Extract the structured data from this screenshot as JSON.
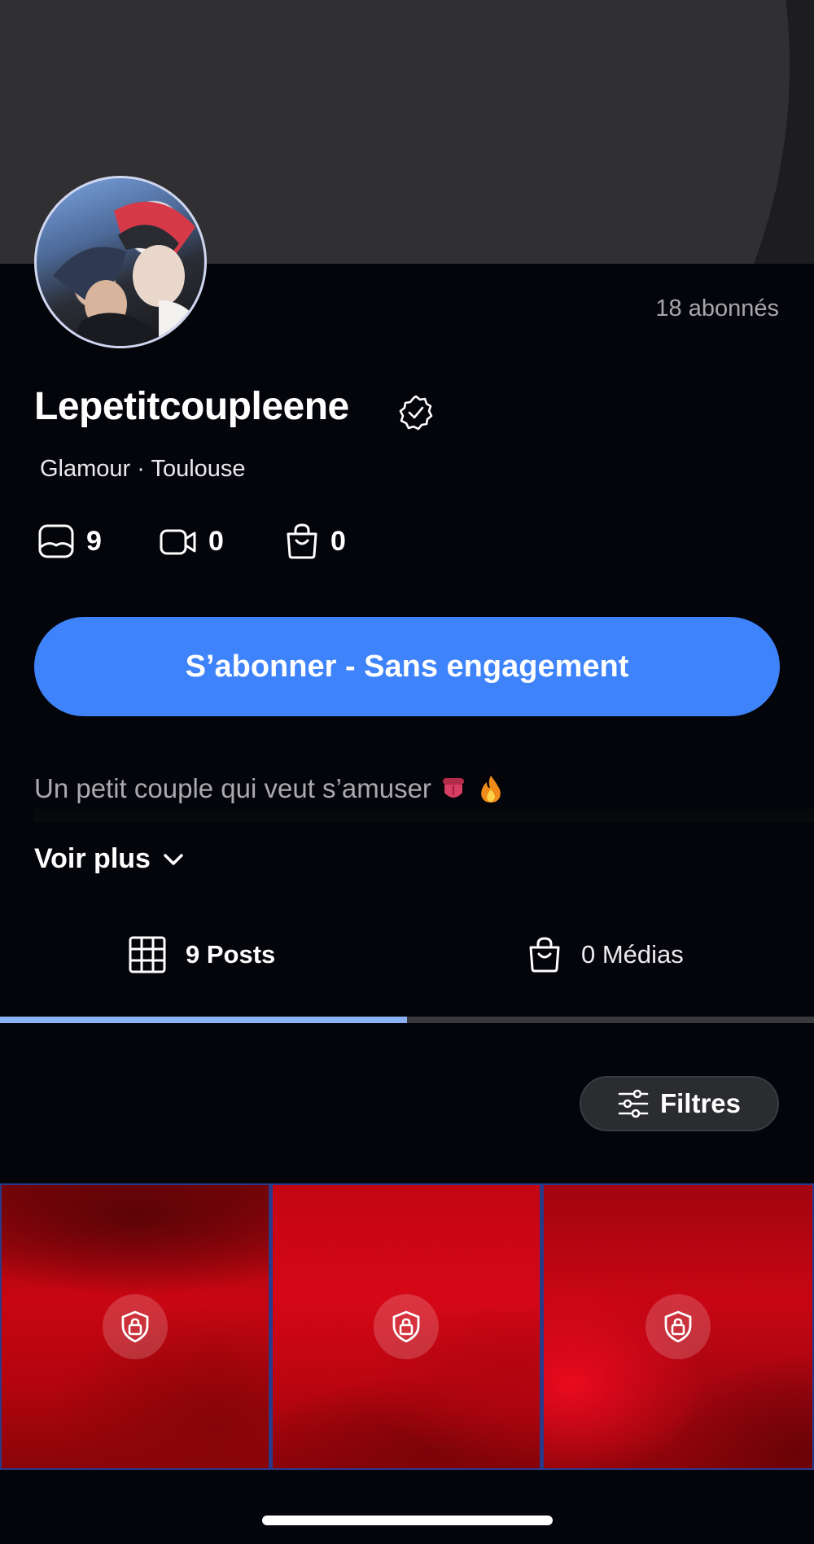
{
  "profile": {
    "subscribers": "18 abonnés",
    "name": "Lepetitcoupleene",
    "location": "Glamour · Toulouse",
    "bio": "Un petit couple qui veut s’amuser",
    "bio_emojis": [
      "tongue-emoji",
      "fire-emoji"
    ],
    "see_more": "Voir plus"
  },
  "stats": [
    {
      "icon": "photo-icon",
      "value": "9"
    },
    {
      "icon": "video-icon",
      "value": "0"
    },
    {
      "icon": "bag-icon",
      "value": "0"
    }
  ],
  "cta": {
    "label": "S’abonner - Sans engagement",
    "color": "#3f83fb"
  },
  "tabs": [
    {
      "icon": "grid-icon",
      "label": "9 Posts",
      "active": true
    },
    {
      "icon": "bag-icon",
      "label": "0 Médias",
      "active": false
    }
  ],
  "filters": {
    "label": "Filtres",
    "icon": "sliders-icon"
  },
  "posts": [
    {
      "locked": true,
      "icon": "lock-shield-icon"
    },
    {
      "locked": true,
      "icon": "lock-shield-icon"
    },
    {
      "locked": true,
      "icon": "lock-shield-icon"
    }
  ],
  "colors": {
    "accent": "#3f83fb",
    "tab_indicator": "#8bb1f6",
    "background": "#04050a"
  }
}
